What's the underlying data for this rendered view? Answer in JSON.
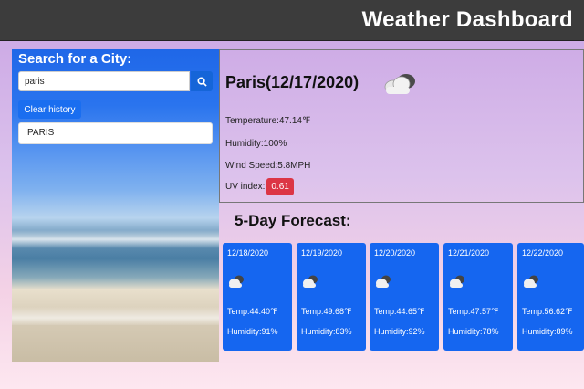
{
  "header": {
    "title": "Weather Dashboard"
  },
  "sidebar": {
    "heading": "Search for a City:",
    "search_value": "paris",
    "clear_label": "Clear history",
    "history": [
      "PARIS"
    ]
  },
  "current": {
    "city_date": "Paris(12/17/2020)",
    "icon": "cloudy-icon",
    "temperature": "Temperature:47.14℉",
    "humidity": "Humidity:100%",
    "wind": "Wind Speed:5.8MPH",
    "uv_label": "UV index:",
    "uv_value": "0.61"
  },
  "forecast": {
    "title": "5-Day Forecast:",
    "days": [
      {
        "date": "12/18/2020",
        "temp": "Temp:44.40℉",
        "humidity": "Humidity:91%",
        "icon": "cloudy-icon"
      },
      {
        "date": "12/19/2020",
        "temp": "Temp:49.68℉",
        "humidity": "Humidity:83%",
        "icon": "cloudy-icon"
      },
      {
        "date": "12/20/2020",
        "temp": "Temp:44.65℉",
        "humidity": "Humidity:92%",
        "icon": "cloudy-icon"
      },
      {
        "date": "12/21/2020",
        "temp": "Temp:47.57℉",
        "humidity": "Humidity:78%",
        "icon": "cloudy-icon"
      },
      {
        "date": "12/22/2020",
        "temp": "Temp:56.62℉",
        "humidity": "Humidity:89%",
        "icon": "cloudy-icon"
      }
    ]
  },
  "colors": {
    "header_bg": "#3c3c3c",
    "accent": "#1566f0",
    "uv_badge": "#dc3545"
  }
}
